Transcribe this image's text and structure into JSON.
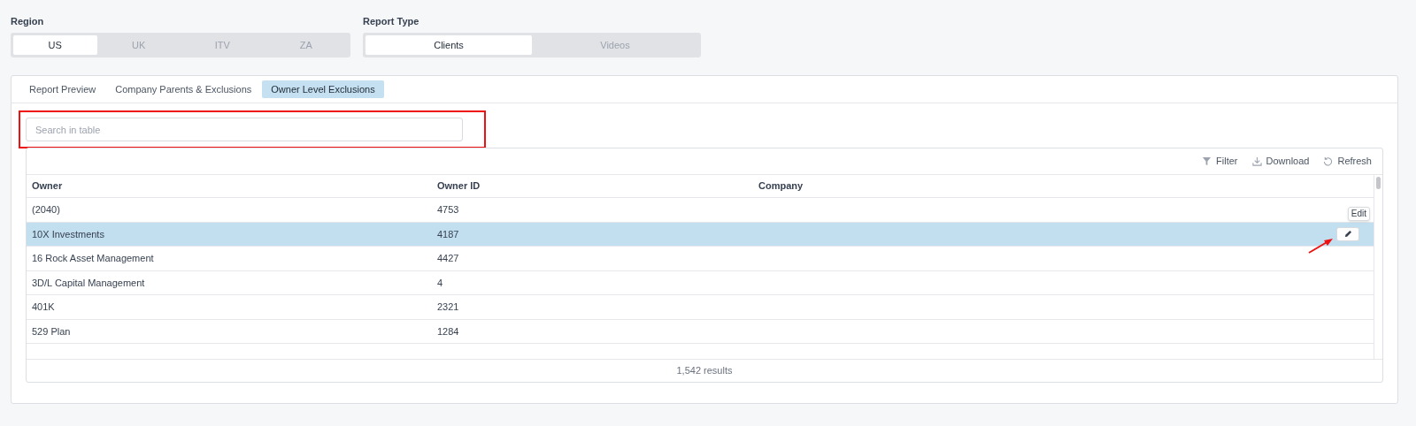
{
  "region": {
    "label": "Region",
    "options": [
      {
        "label": "US",
        "selected": true
      },
      {
        "label": "UK",
        "selected": false
      },
      {
        "label": "ITV",
        "selected": false
      },
      {
        "label": "ZA",
        "selected": false
      }
    ]
  },
  "report_type": {
    "label": "Report Type",
    "options": [
      {
        "label": "Clients",
        "selected": true
      },
      {
        "label": "Videos",
        "selected": false
      }
    ]
  },
  "tabs": [
    {
      "label": "Report Preview",
      "selected": false
    },
    {
      "label": "Company Parents & Exclusions",
      "selected": false
    },
    {
      "label": "Owner Level Exclusions",
      "selected": true
    }
  ],
  "search": {
    "placeholder": "Search in table"
  },
  "toolbar": [
    {
      "kind": "filter",
      "label": "Filter"
    },
    {
      "kind": "download",
      "label": "Download"
    },
    {
      "kind": "refresh",
      "label": "Refresh"
    }
  ],
  "table": {
    "columns": [
      "Owner",
      "Owner ID",
      "Company"
    ],
    "rows": [
      {
        "owner": "(2040)",
        "owner_id": "4753",
        "selected": false
      },
      {
        "owner": "10X Investments",
        "owner_id": "4187",
        "selected": true
      },
      {
        "owner": "16 Rock Asset Management",
        "owner_id": "4427",
        "selected": false
      },
      {
        "owner": "3D/L Capital Management",
        "owner_id": "4",
        "selected": false
      },
      {
        "owner": "401K",
        "owner_id": "2321",
        "selected": false
      },
      {
        "owner": "529 Plan",
        "owner_id": "1284",
        "selected": false
      }
    ],
    "footer": "1,542 results"
  },
  "tooltip": "Edit"
}
